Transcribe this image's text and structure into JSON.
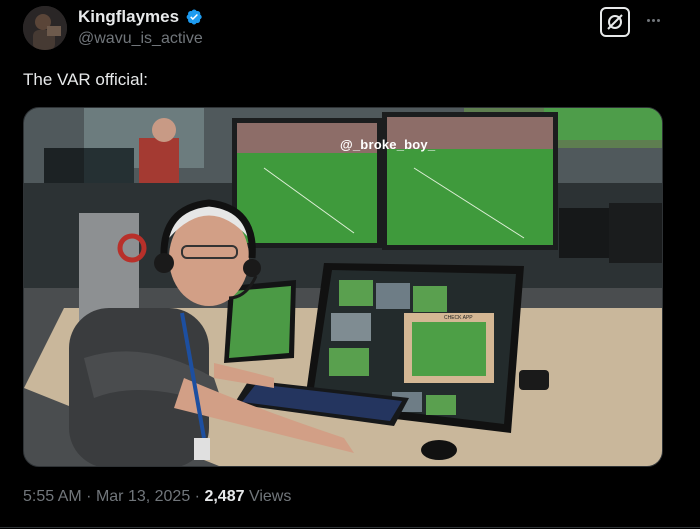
{
  "tweet": {
    "display_name": "Kingflaymes",
    "handle": "@wavu_is_active",
    "text": "The VAR official:",
    "time": "5:55 AM",
    "date": "Mar 13, 2025",
    "views_count": "2,487",
    "views_label": "Views",
    "separator": "·"
  },
  "media": {
    "watermark": "@_broke_boy_",
    "screen_label": "CHECK APP"
  },
  "icons": {
    "verified": "verified-badge-icon",
    "grok": "grok-icon",
    "more": "more-horizontal-icon"
  },
  "colors": {
    "background": "#000000",
    "text_primary": "#e7e9ea",
    "text_secondary": "#71767b",
    "verified_blue": "#1d9bf0"
  }
}
